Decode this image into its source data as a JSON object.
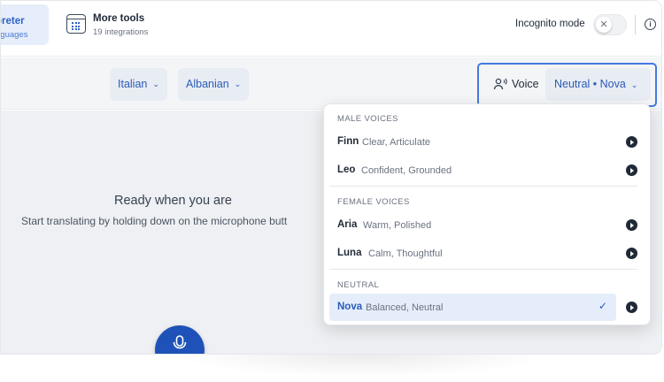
{
  "topbar": {
    "interpreter_tab": {
      "title": "preter",
      "subtitle": "nguages"
    },
    "more_tools": {
      "title": "More tools",
      "subtitle": "19 integrations",
      "icon": "tools-grid-icon"
    },
    "incognito": {
      "label": "Incognito mode",
      "enabled": false,
      "knob_icon": "close-icon"
    },
    "info_icon": "info-icon"
  },
  "languages": {
    "source": "Italian",
    "target": "Albanian"
  },
  "voice": {
    "label": "Voice",
    "selected": "Neutral • Nova",
    "icon": "person-voice-icon",
    "highlight_color": "#4479e0"
  },
  "main": {
    "title": "Ready when you are",
    "hint": "Start translating by holding down on the microphone butt",
    "mic_icon": "microphone-icon"
  },
  "dropdown": {
    "sections": [
      {
        "label": "MALE VOICES",
        "options": [
          {
            "name": "Finn",
            "desc": "Clear, Articulate"
          },
          {
            "name": "Leo",
            "desc": "Confident, Grounded"
          }
        ]
      },
      {
        "label": "FEMALE VOICES",
        "options": [
          {
            "name": "Aria",
            "desc": "Warm, Polished"
          },
          {
            "name": "Luna",
            "desc": "Calm, Thoughtful"
          }
        ]
      },
      {
        "label": "NEUTRAL",
        "options": [
          {
            "name": "Nova",
            "desc": "Balanced, Neutral",
            "selected": true
          }
        ]
      }
    ],
    "check_mark": "✓"
  },
  "colors": {
    "accent": "#2a5bb8",
    "mic_button": "#1f52b8",
    "selected_bg": "#e5edfb"
  }
}
